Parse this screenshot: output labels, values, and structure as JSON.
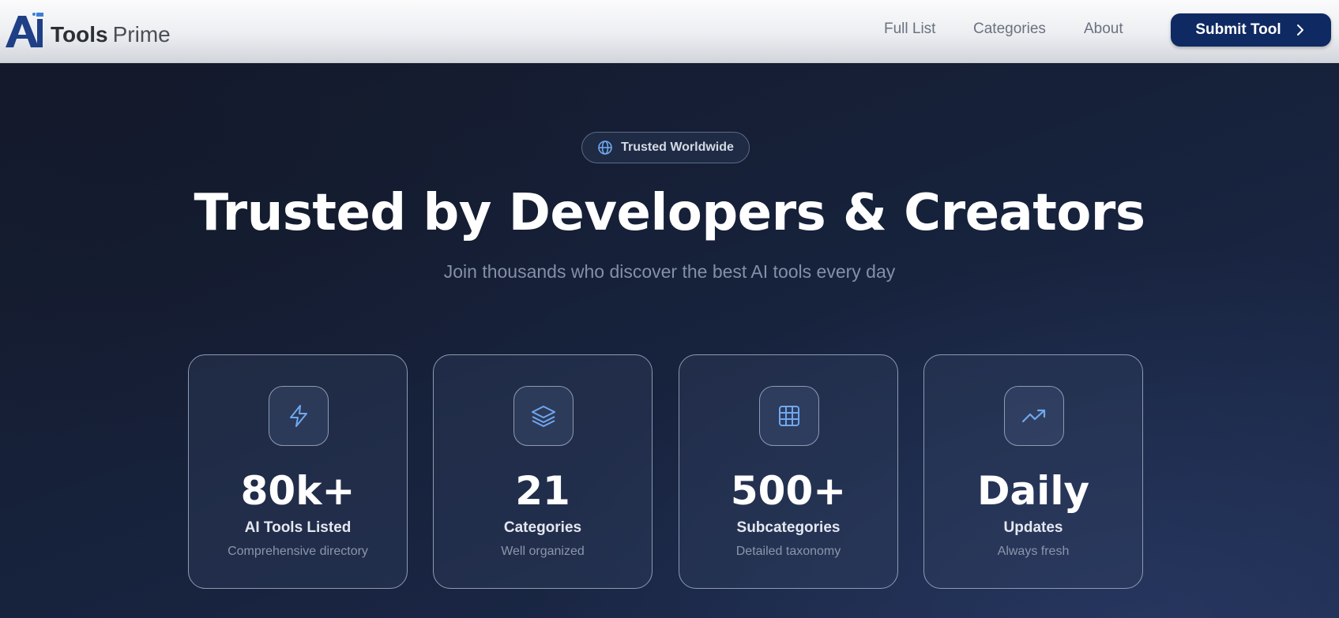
{
  "brand": {
    "logo_mark": "AI",
    "name_part1": "Tools",
    "name_part2": "Prime"
  },
  "nav": {
    "items": [
      {
        "label": "Full List"
      },
      {
        "label": "Categories"
      },
      {
        "label": "About"
      }
    ],
    "submit_label": "Submit Tool",
    "submit_icon": "chevron-right-icon"
  },
  "hero": {
    "badge": {
      "icon": "globe-icon",
      "label": "Trusted Worldwide"
    },
    "title": "Trusted by Developers & Creators",
    "subtitle": "Join thousands who discover the best AI tools every day"
  },
  "stats": [
    {
      "icon": "lightning-icon",
      "value": "80k+",
      "label": "AI Tools Listed",
      "description": "Comprehensive directory"
    },
    {
      "icon": "layers-icon",
      "value": "21",
      "label": "Categories",
      "description": "Well organized"
    },
    {
      "icon": "grid-icon",
      "value": "500+",
      "label": "Subcategories",
      "description": "Detailed taxonomy"
    },
    {
      "icon": "trending-up-icon",
      "value": "Daily",
      "label": "Updates",
      "description": "Always fresh"
    }
  ],
  "colors": {
    "brand_navy": "#0f2a62",
    "hero_background": "#16213a",
    "icon_accent": "#6fa8f0"
  }
}
